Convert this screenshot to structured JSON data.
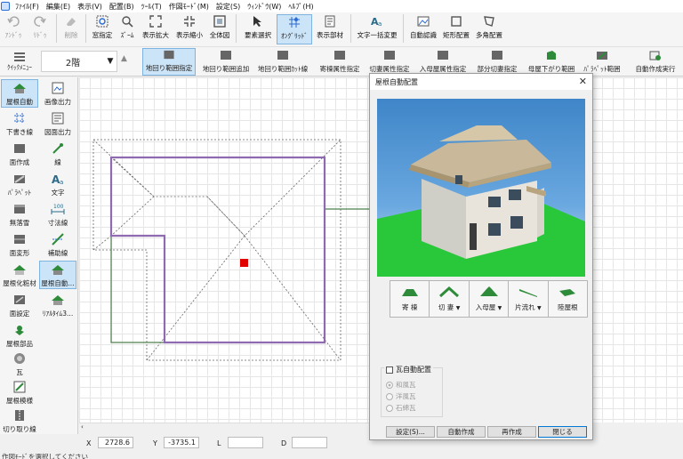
{
  "menu": [
    "ﾌｧｲﾙ(F)",
    "編集(E)",
    "表示(V)",
    "配置(B)",
    "ﾂｰﾙ(T)",
    "作図ﾓｰﾄﾞ(M)",
    "設定(S)",
    "ｳｨﾝﾄﾞｳ(W)",
    "ﾍﾙﾌﾟ(H)"
  ],
  "toolbar1": {
    "undo": "ｱﾝﾄﾞｩ",
    "redo": "ﾘﾄﾞｩ",
    "delete": "削除",
    "window_zoom": "窓指定",
    "zoom": "ｽﾞｰﾑ",
    "zoom_in": "表示拡大",
    "zoom_out": "表示縮小",
    "fit_all": "全体図",
    "element_select": "要素選択",
    "on_grid": "ｵﾝｸﾞﾘｯﾄﾞ",
    "display_parts": "表示部材",
    "bulk_text_change": "文字一括変更",
    "auto_recognize": "自動認識",
    "rect_place": "矩形配置",
    "polygon_place": "多角配置"
  },
  "toolbar2": {
    "quick_menu": "ｸｲｯｸﾒﾆｭｰ",
    "floor": "2階",
    "outline_specify": "地回り範囲指定",
    "outline_add": "地回り範囲追加",
    "outline_cut": "地回り範囲ｶｯﾄ線",
    "hip_attr": "寄棟属性指定",
    "gable_attr": "切妻属性指定",
    "irimoya_attr": "入母屋属性指定",
    "partial_switch": "部分切妻指定",
    "lower_range": "母屋下がり範囲",
    "parapet_range": "ﾊﾟﾗﾍﾟｯﾄ範囲",
    "auto_run": "自動作成実行"
  },
  "left": {
    "roof_auto": "屋根自動",
    "image_output": "画像出力",
    "draft_line": "下書き線",
    "drawing_output": "図面出力",
    "face_create": "面作成",
    "line": "線",
    "parapet": "ﾊﾟﾗﾍﾟｯﾄ",
    "text": "文字",
    "no_gutter": "無落雪",
    "dimension_line": "寸法線",
    "face_deform": "面変形",
    "aux_line": "補助線",
    "roof_finish": "屋根化粧材",
    "roof_auto2": "屋根自動...",
    "face_setting": "面設定",
    "realtime3d": "ﾘｱﾙﾀｲﾑ3...",
    "roof_parts": "屋根部品",
    "tile": "瓦",
    "roof_pattern": "屋根模様",
    "cut_line": "切り取り線"
  },
  "status": {
    "x_label": "X",
    "x_value": "2728.6",
    "y_label": "Y",
    "y_value": "-3735.1",
    "l_label": "L",
    "d_label": "D",
    "message": "作図ﾓｰﾄﾞを選択してください"
  },
  "dialog": {
    "title": "屋根自動配置",
    "hip": "寄 棟",
    "gable": "切 妻",
    "irimoya": "入母屋",
    "shed": "片流れ",
    "flat": "陸屋根",
    "tile_auto": "瓦自動配置",
    "wafu": "和風瓦",
    "yofu": "洋風瓦",
    "sekimen": "石綿瓦",
    "settings": "設定(S)...",
    "auto_create": "自動作成",
    "recreate": "再作成",
    "close": "閉じる"
  },
  "colors": {
    "accent": "#0078d7",
    "roof_outline": "#8e6bb0",
    "wall_line": "#4f7f4f",
    "marker": "#e00000",
    "ground": "#28c83a"
  }
}
